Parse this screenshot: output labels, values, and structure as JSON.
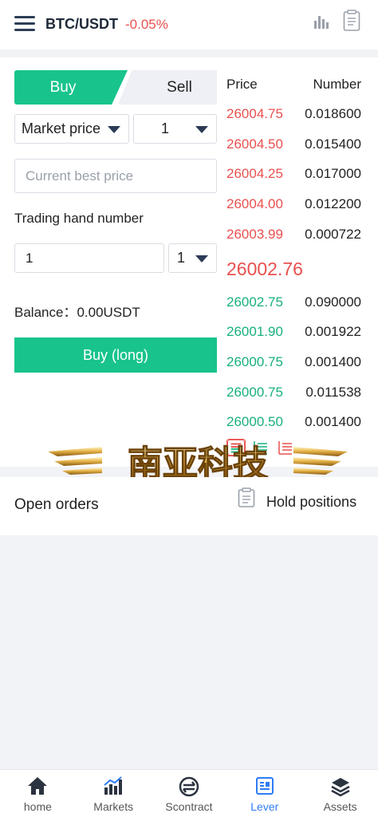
{
  "header": {
    "pair": "BTC/USDT",
    "change": "-0.05%"
  },
  "trade_form": {
    "tabs": {
      "buy": "Buy",
      "sell": "Sell",
      "active": "buy"
    },
    "order_type": "Market price",
    "multiplier_top": "1",
    "price_placeholder": "Current best price",
    "hand_label": "Trading hand number",
    "quantity": "1",
    "multiplier_bottom": "1",
    "balance_label": "Balance：",
    "balance_value": "0.00USDT",
    "buy_button": "Buy (long)"
  },
  "order_book": {
    "price_header": "Price",
    "number_header": "Number",
    "asks": [
      {
        "price": "26004.75",
        "number": "0.018600"
      },
      {
        "price": "26004.50",
        "number": "0.015400"
      },
      {
        "price": "26004.25",
        "number": "0.017000"
      },
      {
        "price": "26004.00",
        "number": "0.012200"
      },
      {
        "price": "26003.99",
        "number": "0.000722"
      }
    ],
    "last_price": "26002.76",
    "bids": [
      {
        "price": "26002.75",
        "number": "0.090000"
      },
      {
        "price": "26001.90",
        "number": "0.001922"
      },
      {
        "price": "26000.75",
        "number": "0.001400"
      },
      {
        "price": "26000.75",
        "number": "0.011538"
      },
      {
        "price": "26000.50",
        "number": "0.001400"
      }
    ]
  },
  "watermark_text": "南亚科技",
  "orders": {
    "title": "Open orders",
    "hold_positions": "Hold positions"
  },
  "nav": {
    "items": [
      {
        "label": "home",
        "icon": "home-icon"
      },
      {
        "label": "Markets",
        "icon": "markets-icon"
      },
      {
        "label": "Scontract",
        "icon": "contract-icon"
      },
      {
        "label": "Lever",
        "icon": "lever-icon"
      },
      {
        "label": "Assets",
        "icon": "assets-icon"
      }
    ],
    "active": "Lever"
  },
  "colors": {
    "green": "#18c48c",
    "red": "#e8504f",
    "nav_active": "#2e7cf6"
  }
}
